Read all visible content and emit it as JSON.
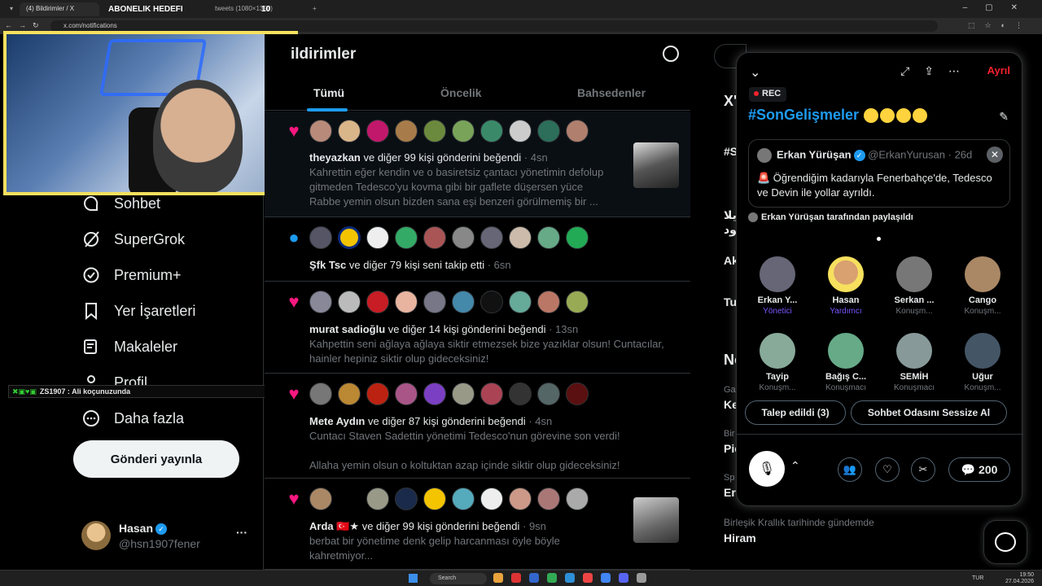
{
  "browser": {
    "tabs": [
      "(4) Bildirimler / X",
      "",
      "",
      "tweets (1080×1350)"
    ],
    "overlay_title": "ABONELIK HEDEFI",
    "overlay_number": "10",
    "url": "x.com/notifications"
  },
  "sidebar": {
    "items": [
      {
        "label": "Sohbet",
        "icon": "chat-bubble-icon"
      },
      {
        "label": "SuperGrok",
        "icon": "grok-icon"
      },
      {
        "label": "Premium+",
        "icon": "verified-badge-icon"
      },
      {
        "label": "Yer İşaretleri",
        "icon": "bookmark-icon"
      },
      {
        "label": "Makaleler",
        "icon": "article-icon"
      },
      {
        "label": "Profil",
        "icon": "person-icon"
      },
      {
        "label": "Daha fazla",
        "icon": "more-circle-icon"
      }
    ],
    "post_button": "Gönderi yayınla",
    "account": {
      "name": "Hasan",
      "handle": "@hsn1907fener"
    }
  },
  "chat_overlay": {
    "text": "ZS1907 : Ali koçunuzunda"
  },
  "main": {
    "title": "ildirimler",
    "tabs": [
      "Tümü",
      "Öncelik",
      "Bahsedenler"
    ],
    "notifications": [
      {
        "type": "like",
        "user": "theyazkan",
        "action": " ve diğer 99 kişi gönderini beğendi",
        "time": " · 4sn",
        "lines": [
          "Kahrettin eğer kendin ve o basiretsiz çantacı yönetimin defolup",
          "gitmeden Tedesco'yu kovma gibi bir gaflete düşersen yüce",
          "Rabbe yemin olsun bizden sana eşi benzeri görülmemiş bir ..."
        ]
      },
      {
        "type": "follow",
        "user": "Şfk Tsc",
        "action": " ve diğer 79 kişi seni takip etti",
        "time": " · 6sn",
        "lines": []
      },
      {
        "type": "like",
        "user": "murat sadioğlu",
        "action": " ve diğer 14 kişi gönderini beğendi",
        "time": " · 13sn",
        "lines": [
          "Kahpettin seni ağlaya ağlaya siktir etmezsek bize yazıklar olsun! Cuntacılar,",
          "hainler hepiniz siktir olup gideceksiniz!"
        ]
      },
      {
        "type": "like",
        "user": "Mete Aydın",
        "action": " ve diğer 87 kişi gönderini beğendi",
        "time": " · 4sn",
        "lines": [
          "Cuntacı Staven Sadettin yönetimi Tedesco'nun görevine son verdi!",
          "",
          "Allaha yemin olsun o koltuktan azap içinde siktir olup gideceksiniz!"
        ]
      },
      {
        "type": "like",
        "user": "Arda 🇹🇷★",
        "action": " ve diğer 99 kişi gönderini beğendi",
        "time": " · 9sn",
        "lines": [
          "berbat bir yönetime denk gelip harcanması öyle böyle",
          "kahretmiyor..."
        ]
      }
    ]
  },
  "right": {
    "fragments": [
      "X'",
      "#S",
      "یلا",
      "یود",
      "Ak",
      "Tu",
      "No",
      "Ga",
      "Ke",
      "Bir",
      "Pic",
      "Sp",
      "Ers"
    ],
    "trend_label": "Birleşik Krallık tarihinde gündemde",
    "trend_name": "Hiram"
  },
  "space": {
    "leave": "Ayrıl",
    "rec": "REC",
    "title": "#SonGelişmeler",
    "pinned": {
      "name": "Erkan Yürüşan",
      "handle": "@ErkanYurusan · 26d",
      "text": "🚨 Öğrendiğim kadarıyla Fenerbahçe'de, Tedesco ve Devin ile yollar ayrıldı."
    },
    "shared_by": "Erkan Yürüşan tarafından paylaşıldı",
    "people": [
      {
        "name": "Erkan Y...",
        "role": "Yönetici"
      },
      {
        "name": "Hasan",
        "role": "Yardımcı"
      },
      {
        "name": "Serkan ...",
        "role": "Konuşm..."
      },
      {
        "name": "Cango",
        "role": "Konuşm..."
      },
      {
        "name": "Tayip",
        "role": "Konuşm..."
      },
      {
        "name": "Bağış C...",
        "role": "Konuşmacı"
      },
      {
        "name": "SEMİH",
        "role": "Konuşmacı"
      },
      {
        "name": "Uğur",
        "role": "Konuşm..."
      }
    ],
    "request_pill": "Talep edildi (3)",
    "mute_pill": "Sohbet Odasını Sessize Al",
    "comment_count": "200"
  },
  "taskbar": {
    "search": "Search",
    "lang": "TUR",
    "time": "19:50",
    "date": "27.04.2026"
  },
  "colors": {
    "accent": "#1d9bf0",
    "like": "#f91880",
    "webcam_border": "#f6e05e"
  }
}
